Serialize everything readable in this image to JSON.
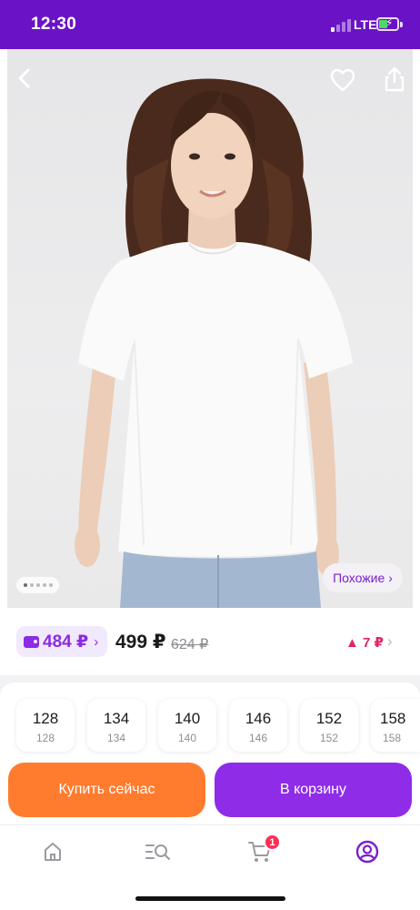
{
  "status_bar": {
    "time": "12:30",
    "network": "LTE"
  },
  "product": {
    "similar_label": "Похожие",
    "gallery_total": 5,
    "gallery_current": 1
  },
  "price": {
    "wallet_amount": "484 ₽",
    "current": "499 ₽",
    "old": "624 ₽",
    "change": "7 ₽"
  },
  "sizes": [
    {
      "label": "128",
      "sub": "128"
    },
    {
      "label": "134",
      "sub": "134"
    },
    {
      "label": "140",
      "sub": "140"
    },
    {
      "label": "146",
      "sub": "146"
    },
    {
      "label": "152",
      "sub": "152"
    },
    {
      "label": "158",
      "sub": "158"
    }
  ],
  "actions": {
    "buy_now": "Купить сейчас",
    "add_to_cart": "В корзину"
  },
  "tabbar": {
    "cart_badge": "1",
    "active_tab": "profile"
  },
  "colors": {
    "brand": "#6a13c6",
    "accent_purple": "#8e2ce8",
    "buy_orange": "#ff7b2e",
    "price_change": "#e0245e"
  },
  "icons": [
    "back-arrow-icon",
    "heart-icon",
    "share-icon",
    "chevron-right-icon",
    "wallet-icon",
    "triangle-up-icon",
    "home-icon",
    "catalog-search-icon",
    "cart-icon",
    "profile-icon"
  ]
}
